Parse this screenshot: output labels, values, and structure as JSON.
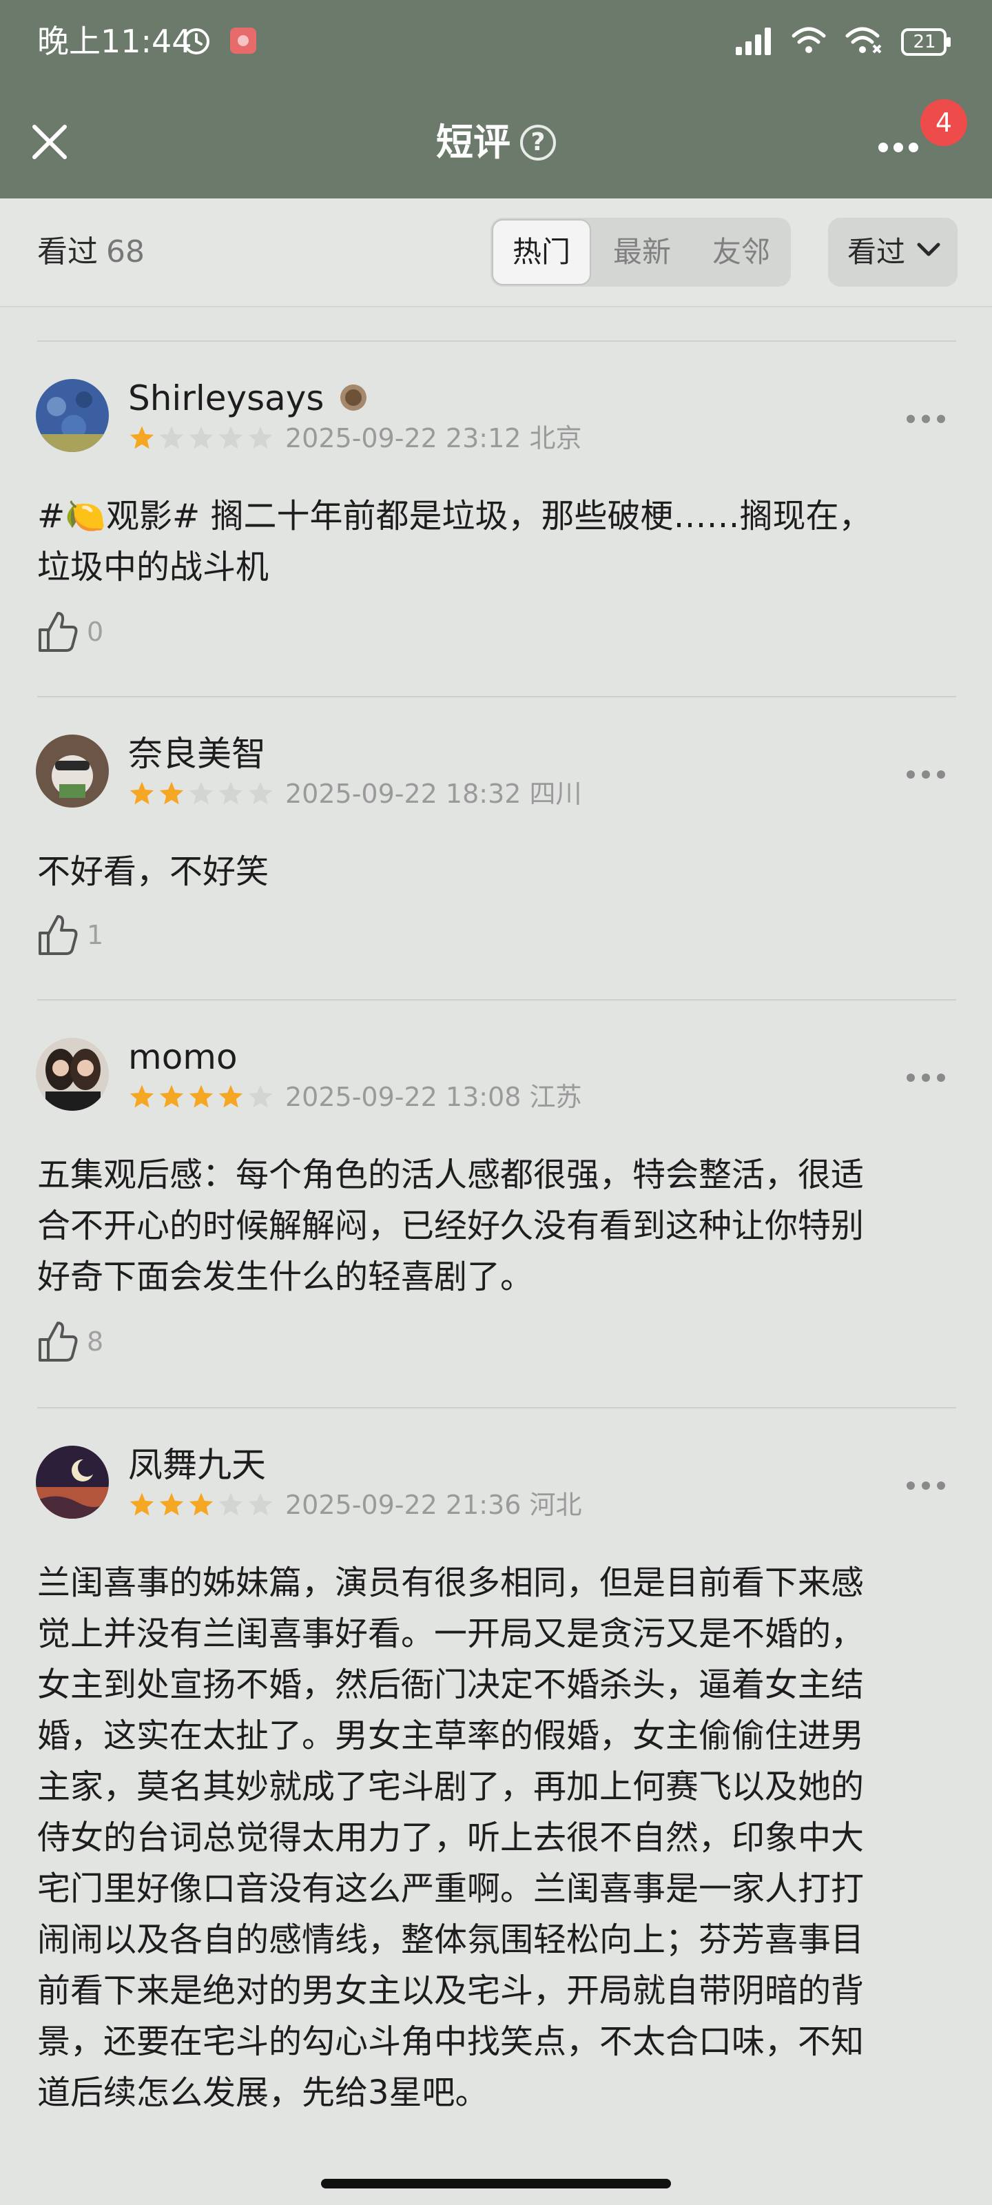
{
  "status_bar": {
    "time": "晚上11:44",
    "battery": "21"
  },
  "header": {
    "title": "短评",
    "notification_count": "4"
  },
  "filter": {
    "watched_label": "看过",
    "watched_count": "68",
    "tabs": [
      "热门",
      "最新",
      "友邻"
    ],
    "active_tab": "热门",
    "dropdown_label": "看过"
  },
  "colors": {
    "header_bg": "#6c7a6c",
    "page_bg": "#e2e4e2",
    "star_filled": "#f5a623",
    "badge_red": "#ee4b4b"
  },
  "reviews": [
    {
      "username": "Shirleysays",
      "rating": 1,
      "datetime": "2025-09-22 23:12",
      "location": "北京",
      "text_lines": [
        "#🍋观影# 搁二十年前都是垃圾，那些破梗……搁现在，",
        "垃圾中的战斗机"
      ],
      "likes": "0"
    },
    {
      "username": "奈良美智",
      "rating": 2,
      "datetime": "2025-09-22 18:32",
      "location": "四川",
      "text_lines": [
        "不好看，不好笑"
      ],
      "likes": "1"
    },
    {
      "username": "momo",
      "rating": 4,
      "datetime": "2025-09-22 13:08",
      "location": "江苏",
      "text_lines": [
        "五集观后感：每个角色的活人感都很强，特会整活，很适",
        "合不开心的时候解解闷，已经好久没有看到这种让你特别",
        "好奇下面会发生什么的轻喜剧了。"
      ],
      "likes": "8"
    },
    {
      "username": "凤舞九天",
      "rating": 3,
      "datetime": "2025-09-22 21:36",
      "location": "河北",
      "text_lines": [
        "兰闺喜事的姊妹篇，演员有很多相同，但是目前看下来感",
        "觉上并没有兰闺喜事好看。一开局又是贪污又是不婚的，",
        "女主到处宣扬不婚，然后衙门决定不婚杀头，逼着女主结",
        "婚，这实在太扯了。男女主草率的假婚，女主偷偷住进男",
        "主家，莫名其妙就成了宅斗剧了，再加上何赛飞以及她的",
        "侍女的台词总觉得太用力了，听上去很不自然，印象中大",
        "宅门里好像口音没有这么严重啊。兰闺喜事是一家人打打",
        "闹闹以及各自的感情线，整体氛围轻松向上；芬芳喜事目",
        "前看下来是绝对的男女主以及宅斗，开局就自带阴暗的背",
        "景，还要在宅斗的勾心斗角中找笑点，不太合口味，不知",
        "道后续怎么发展，先给3星吧。"
      ],
      "likes": ""
    }
  ]
}
